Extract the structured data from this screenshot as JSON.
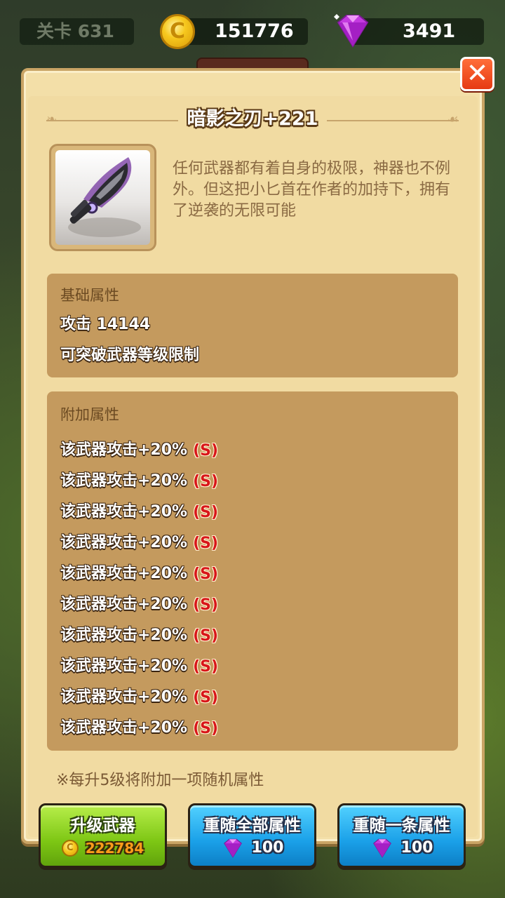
{
  "topbar": {
    "level": "关卡 631",
    "coins": "151776",
    "gems": "3491",
    "coin_symbol": "C"
  },
  "close": {
    "label": "✕"
  },
  "item": {
    "title": "暗影之刃+221",
    "description": "任何武器都有着自身的极限，神器也不例外。但这把小匕首在作者的加持下，拥有了逆袭的无限可能",
    "icon": "shadow-blade-icon"
  },
  "base_attributes": {
    "label": "基础属性",
    "lines": [
      "攻击 14144",
      "可突破武器等级限制"
    ]
  },
  "extra_attributes": {
    "label": "附加属性",
    "items": [
      {
        "text": "该武器攻击+20%",
        "grade": "(S)"
      },
      {
        "text": "该武器攻击+20%",
        "grade": "(S)"
      },
      {
        "text": "该武器攻击+20%",
        "grade": "(S)"
      },
      {
        "text": "该武器攻击+20%",
        "grade": "(S)"
      },
      {
        "text": "该武器攻击+20%",
        "grade": "(S)"
      },
      {
        "text": "该武器攻击+20%",
        "grade": "(S)"
      },
      {
        "text": "该武器攻击+20%",
        "grade": "(S)"
      },
      {
        "text": "该武器攻击+20%",
        "grade": "(S)"
      },
      {
        "text": "该武器攻击+20%",
        "grade": "(S)"
      },
      {
        "text": "该武器攻击+20%",
        "grade": "(S)"
      }
    ]
  },
  "note": "※每升5级将附加一项随机属性",
  "buttons": {
    "upgrade": {
      "label": "升级武器",
      "cost": "222784",
      "coin_symbol": "C"
    },
    "reroll_all": {
      "label": "重随全部属性",
      "cost": "100"
    },
    "reroll_one": {
      "label": "重随一条属性",
      "cost": "100"
    }
  },
  "colors": {
    "panel": "#f3dfa8",
    "attr_box": "#c49a5e",
    "grade_red": "#d8161a",
    "button_green": "#7dc614",
    "button_blue": "#1aa0e8",
    "gem_purple": "#c43ae0"
  }
}
